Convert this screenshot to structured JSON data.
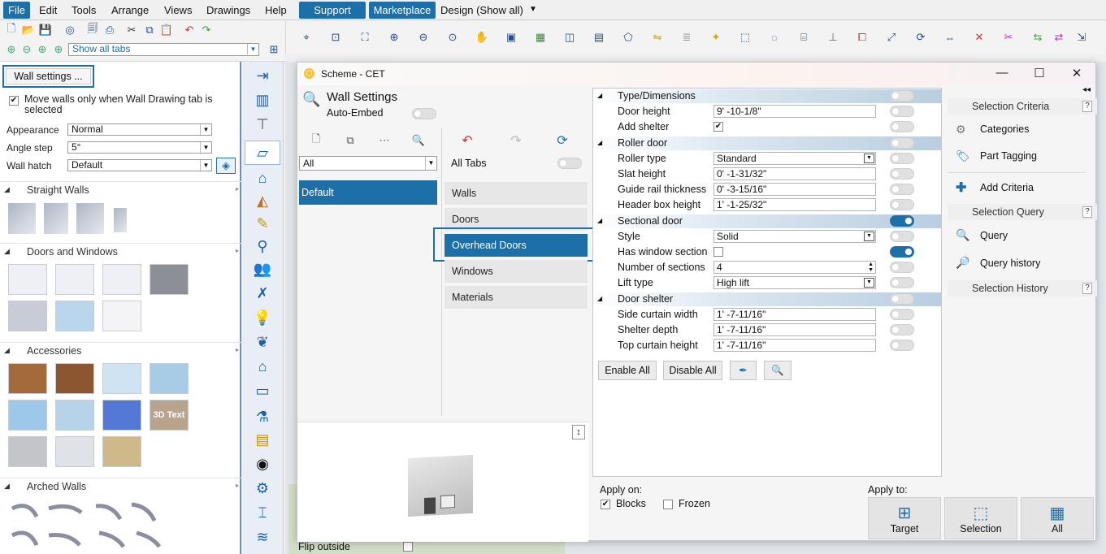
{
  "menubar": {
    "items": [
      "File",
      "Edit",
      "Tools",
      "Arrange",
      "Views",
      "Drawings",
      "Help"
    ],
    "support": "Support",
    "marketplace": "Marketplace",
    "design_selector": "Design (Show all)"
  },
  "quick_toolbar": {
    "filter_value": "Show all tabs"
  },
  "left_panel": {
    "wall_settings_button": "Wall settings ...",
    "move_walls_label": "Move walls only when Wall Drawing tab is selected",
    "appearance_label": "Appearance",
    "appearance_value": "Normal",
    "angle_step_label": "Angle step",
    "angle_step_value": "5°",
    "wall_hatch_label": "Wall hatch",
    "wall_hatch_value": "Default",
    "sections": [
      "Straight Walls",
      "Doors and Windows",
      "Accessories",
      "Arched Walls"
    ],
    "accessory_3d_text": "3D Text"
  },
  "dialog": {
    "title": "Scheme - CET",
    "header_title": "Wall Settings",
    "auto_embed_label": "Auto-Embed",
    "scheme_filter": "All",
    "scheme_list": [
      "Default"
    ],
    "all_tabs_label": "All Tabs",
    "tabs": [
      "Walls",
      "Doors",
      "Overhead Doors",
      "Windows",
      "Materials"
    ],
    "flip_outside_label": "Flip outside"
  },
  "properties": {
    "type_dimensions": {
      "header": "Type/Dimensions",
      "door_height_label": "Door height",
      "door_height_value": "9' -10-1/8\"",
      "add_shelter_label": "Add shelter"
    },
    "roller_door": {
      "header": "Roller door",
      "roller_type_label": "Roller type",
      "roller_type_value": "Standard",
      "slat_height_label": "Slat height",
      "slat_height_value": "0' -1-31/32\"",
      "guide_rail_label": "Guide rail thickness",
      "guide_rail_value": "0' -3-15/16\"",
      "header_box_label": "Header box height",
      "header_box_value": "1' -1-25/32\""
    },
    "sectional_door": {
      "header": "Sectional door",
      "style_label": "Style",
      "style_value": "Solid",
      "has_window_label": "Has window section",
      "sections_label": "Number of sections",
      "sections_value": "4",
      "lift_type_label": "Lift type",
      "lift_type_value": "High lift"
    },
    "door_shelter": {
      "header": "Door shelter",
      "side_curtain_label": "Side curtain width",
      "side_curtain_value": "1' -7-11/16\"",
      "shelter_depth_label": "Shelter depth",
      "shelter_depth_value": "1' -7-11/16\"",
      "top_curtain_label": "Top curtain height",
      "top_curtain_value": "1' -7-11/16\""
    },
    "enable_all": "Enable All",
    "disable_all": "Disable All"
  },
  "apply": {
    "apply_on_label": "Apply on:",
    "blocks_label": "Blocks",
    "frozen_label": "Frozen",
    "apply_to_label": "Apply to:",
    "target_label": "Target",
    "selection_label": "Selection",
    "all_label": "All"
  },
  "right_panel": {
    "selection_criteria": "Selection Criteria",
    "categories": "Categories",
    "part_tagging": "Part Tagging",
    "add_criteria": "Add Criteria",
    "selection_query": "Selection Query",
    "query": "Query",
    "query_history": "Query history",
    "selection_history": "Selection History"
  }
}
